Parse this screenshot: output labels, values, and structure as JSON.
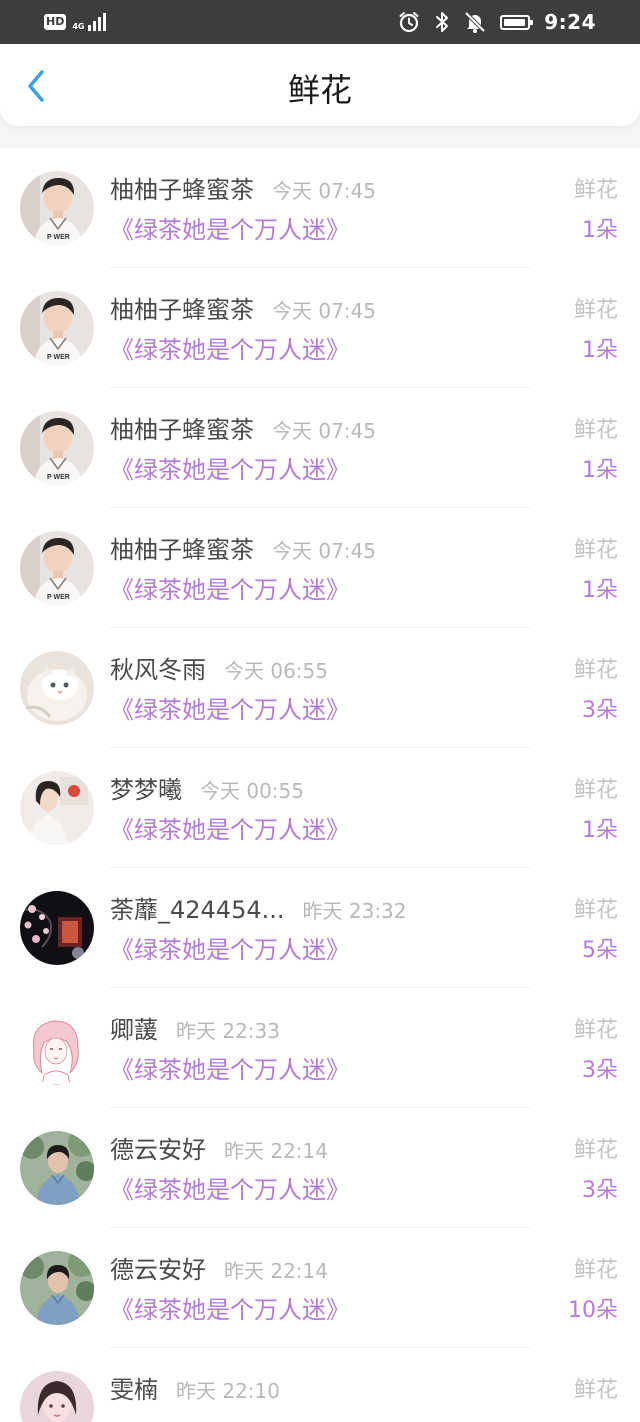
{
  "status_bar": {
    "hd": "HD",
    "network": "4G",
    "time": "9:24",
    "icons": [
      "alarm-icon",
      "bluetooth-icon",
      "mute-bell-icon",
      "battery-icon"
    ]
  },
  "header": {
    "title": "鲜花",
    "back_icon": "chevron-left-icon"
  },
  "colors": {
    "accent_purple": "#b47ad8",
    "back_blue": "#3aa0e6",
    "status_bar_bg": "#3d3d3d"
  },
  "records": [
    {
      "name": "柚柚子蜂蜜茶",
      "time": "今天 07:45",
      "book": "《绿茶她是个万人迷》",
      "gift": "鲜花",
      "count": "1朵",
      "avatar": "man-avatar-icon"
    },
    {
      "name": "柚柚子蜂蜜茶",
      "time": "今天 07:45",
      "book": "《绿茶她是个万人迷》",
      "gift": "鲜花",
      "count": "1朵",
      "avatar": "man-avatar-icon"
    },
    {
      "name": "柚柚子蜂蜜茶",
      "time": "今天 07:45",
      "book": "《绿茶她是个万人迷》",
      "gift": "鲜花",
      "count": "1朵",
      "avatar": "man-avatar-icon"
    },
    {
      "name": "柚柚子蜂蜜茶",
      "time": "今天 07:45",
      "book": "《绿茶她是个万人迷》",
      "gift": "鲜花",
      "count": "1朵",
      "avatar": "man-avatar-icon"
    },
    {
      "name": "秋风冬雨",
      "time": "今天 06:55",
      "book": "《绿茶她是个万人迷》",
      "gift": "鲜花",
      "count": "3朵",
      "avatar": "cat-avatar-icon"
    },
    {
      "name": "梦梦曦",
      "time": "今天 00:55",
      "book": "《绿茶她是个万人迷》",
      "gift": "鲜花",
      "count": "1朵",
      "avatar": "girl-avatar-icon"
    },
    {
      "name": "荼蘼_424454...",
      "time": "昨天 23:32",
      "book": "《绿茶她是个万人迷》",
      "gift": "鲜花",
      "count": "5朵",
      "avatar": "night-blossom-avatar-icon"
    },
    {
      "name": "卿蘐",
      "time": "昨天 22:33",
      "book": "《绿茶她是个万人迷》",
      "gift": "鲜花",
      "count": "3朵",
      "avatar": "anime-girl-avatar-icon"
    },
    {
      "name": "德云安好",
      "time": "昨天 22:14",
      "book": "《绿茶她是个万人迷》",
      "gift": "鲜花",
      "count": "3朵",
      "avatar": "boy-outdoor-avatar-icon"
    },
    {
      "name": "德云安好",
      "time": "昨天 22:14",
      "book": "《绿茶她是个万人迷》",
      "gift": "鲜花",
      "count": "10朵",
      "avatar": "boy-outdoor-avatar-icon"
    },
    {
      "name": "雯楠",
      "time": "昨天 22:10",
      "book": "",
      "gift": "鲜花",
      "count": "",
      "avatar": "pink-portrait-avatar-icon"
    }
  ]
}
